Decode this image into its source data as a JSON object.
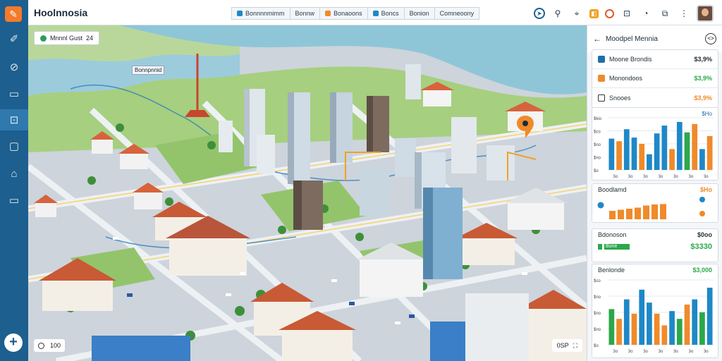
{
  "app": {
    "title": "Hoolnnosia"
  },
  "rail": {
    "items": [
      "pen-icon",
      "compass-icon",
      "chart-icon",
      "trend-icon",
      "shield-icon",
      "building-icon",
      "image-icon"
    ],
    "active_index": 4,
    "add_label": "+"
  },
  "tabs": [
    {
      "label": "Bonnnnmimm",
      "color": "#1e88c7"
    },
    {
      "label": "Bonnw",
      "color": ""
    },
    {
      "label": "Bonaoons",
      "color": "#f08a2a"
    },
    {
      "label": "Boncs",
      "color": "#1e88c7"
    },
    {
      "label": "Bonion",
      "color": ""
    },
    {
      "label": "Comneoony",
      "color": ""
    }
  ],
  "map": {
    "search_label": "Mnnnl Gust",
    "search_suffix": "24",
    "place_label": "Bonnpnnid",
    "zoom_label": "100",
    "scale_label": "0SP"
  },
  "panel": {
    "title": "Moodpel Mennia",
    "metrics": [
      {
        "label": "Moone Brondis",
        "value": "$3,9%",
        "color": "#1e6fa8",
        "value_color": "#1d2b3a"
      },
      {
        "label": "Monondoos",
        "value": "$3,9%",
        "color": "#f08a2a",
        "value_color": "#2ba84a"
      },
      {
        "label": "Snooes",
        "value": "$3,9%",
        "color": "#ffffff",
        "value_color": "#f08a2a"
      }
    ],
    "chart1": {
      "header": "$Ho",
      "ylabels": [
        "$kio",
        "$co",
        "$no",
        "$no",
        "$o"
      ],
      "xlabels": [
        "3o",
        "3o",
        "3o",
        "3o",
        "3o",
        "3o",
        "3o"
      ]
    },
    "chart2": {
      "header_left": "Boodlamd",
      "header_right": "$Ho",
      "legend_colors": [
        "#1e88c7",
        "#1e88c7",
        "#f08a2a"
      ]
    },
    "stat": {
      "label": "Bdonoson",
      "right_top": "$0oo",
      "value": "$3330",
      "bar_label": "Bone"
    },
    "chart3": {
      "header_left": "Benlonde",
      "header_right": "$3,000",
      "ylabels": [
        "$co",
        "$no",
        "$no",
        "$no",
        "$o"
      ],
      "xlabels": [
        "3o",
        "3o",
        "3o",
        "3o",
        "3o",
        "3o",
        "3o"
      ]
    }
  },
  "chart_data": [
    {
      "type": "bar",
      "categories": [
        "3o",
        "3o",
        "3o",
        "3o",
        "3o",
        "3o",
        "3o",
        "3o",
        "3o",
        "3o",
        "3o",
        "3o",
        "3o",
        "3o"
      ],
      "series": [
        {
          "values": [
            60,
            55,
            78,
            62,
            50,
            30,
            70,
            85,
            40,
            92,
            72,
            88,
            40,
            65
          ],
          "colors": [
            "#1e88c7",
            "#f08a2a",
            "#1e88c7",
            "#1e88c7",
            "#f08a2a",
            "#1e88c7",
            "#1e88c7",
            "#1e88c7",
            "#f08a2a",
            "#1e88c7",
            "#2ba84a",
            "#f08a2a",
            "#1e88c7",
            "#f08a2a"
          ]
        }
      ],
      "ylim": [
        0,
        100
      ]
    },
    {
      "type": "area",
      "series": [
        {
          "values": [
            40,
            45,
            50,
            55,
            65,
            70,
            72
          ],
          "colors": [
            "#f08a2a",
            "#f08a2a",
            "#f08a2a",
            "#f08a2a",
            "#f08a2a",
            "#f08a2a",
            "#f08a2a"
          ]
        }
      ],
      "ylim": [
        0,
        100
      ]
    },
    {
      "type": "bar",
      "categories": [
        "3o",
        "3o",
        "3o",
        "3o",
        "3o",
        "3o",
        "3o",
        "3o",
        "3o",
        "3o",
        "3o",
        "3o",
        "3o",
        "3o"
      ],
      "series": [
        {
          "values": [
            55,
            40,
            70,
            48,
            85,
            65,
            48,
            30,
            52,
            40,
            62,
            70,
            50,
            88
          ],
          "colors": [
            "#2ba84a",
            "#f08a2a",
            "#1e88c7",
            "#f08a2a",
            "#1e88c7",
            "#1e88c7",
            "#f08a2a",
            "#f08a2a",
            "#1e88c7",
            "#2ba84a",
            "#f08a2a",
            "#1e88c7",
            "#2ba84a",
            "#1e88c7"
          ]
        }
      ],
      "ylim": [
        0,
        100
      ]
    }
  ]
}
